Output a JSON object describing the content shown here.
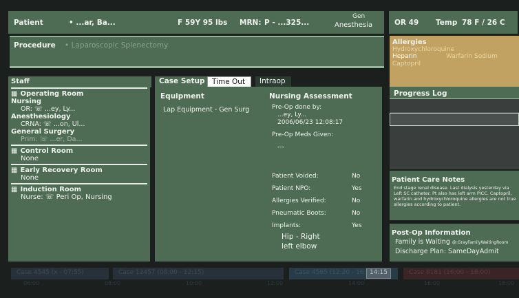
{
  "header": {
    "patient_label": "Patient",
    "patient_name": "• ...ar, Ba...",
    "sex_age_weight": "F  59Y  95 lbs",
    "mrn_label": "MRN:",
    "mrn_value": "P - ...325...",
    "anesthesia_type_1": "Gen",
    "anesthesia_type_2": "Anesthesia",
    "or_number": "OR 49",
    "temp_label": "Temp",
    "temp_value": "78 F / 26 C"
  },
  "procedure": {
    "label": "Procedure",
    "value": "• Laparoscopic Splenectomy"
  },
  "allergies": {
    "title": "Allergies",
    "items": [
      "Hydroxychloroquine",
      "Heparin",
      "Warfarin Sodium",
      "Captopril"
    ]
  },
  "staff": {
    "title": "Staff",
    "operating_room": "Operating Room",
    "nursing": "Nursing",
    "or_role": "OR:",
    "or_name": "...ey, Ly...",
    "anesthesiology": "Anesthesiology",
    "crna_role": "CRNA:",
    "crna_name": "...on, Ul...",
    "general_surgery": "General Surgery",
    "prim_role": "Prim:",
    "prim_name": "...er, Da...",
    "control_room": "Control Room",
    "control_none": "None",
    "early_recovery": "Early Recovery Room",
    "early_none": "None",
    "induction_room": "Induction Room",
    "nurse_role": "Nurse:",
    "nurse_name": "Peri Op, Nursing"
  },
  "tabs": [
    "Case Setup",
    "Time Out",
    "Intraop"
  ],
  "case_setup": {
    "equipment_title": "Equipment",
    "equipment_item": "Lap Equipment - Gen Surg",
    "nursing_title": "Nursing Assessment",
    "preop_done_by": "Pre-Op done by:",
    "preop_name": "...ey, Ly...",
    "preop_time": "2006/06/23 12:08:17",
    "preop_meds": "Pre-Op Meds Given:",
    "preop_meds_value": "---",
    "rows": [
      {
        "label": "Patient Voided:",
        "value": "No"
      },
      {
        "label": "Patient NPO:",
        "value": "Yes"
      },
      {
        "label": "Allergies Verified:",
        "value": "No"
      },
      {
        "label": "Pneumatic Boots:",
        "value": "No"
      },
      {
        "label": "Implants:",
        "value": "Yes"
      }
    ],
    "implants_1": "Hip - Right",
    "implants_2": "left elbow"
  },
  "progress_log": {
    "title": "Progress Log"
  },
  "care_notes": {
    "title": "Patient Care Notes",
    "text": "End stage renal disease. Last dialysis yesterday via Left SC catheter. Pt also has left arm PICC. Captopril, warfarin and hydroxychloroquine allergies are not true allergies according to patient."
  },
  "post_op": {
    "title": "Post-Op Information",
    "family": "Family is Waiting",
    "family_loc": "@:GrayFamilyWaitingRoom",
    "discharge": "Discharge Plan: SameDayAdmit"
  },
  "schedule": {
    "cases": [
      "Case 4545 (x - 07:55)",
      "Case 12457 (08:00 - 12:15)",
      "Case 4565 (12:20 - 16:15)",
      "Case 8181 (16:00 - 18:00)"
    ],
    "current_time": "14:15",
    "ticks": [
      "06:00",
      "08:00",
      "10:00",
      "12:00",
      "14:00",
      "16:00",
      "18:00"
    ]
  },
  "colors": {
    "panel": "#4e6b54",
    "allergy_bg": "#c1a262",
    "background": "#1b1f1e"
  }
}
